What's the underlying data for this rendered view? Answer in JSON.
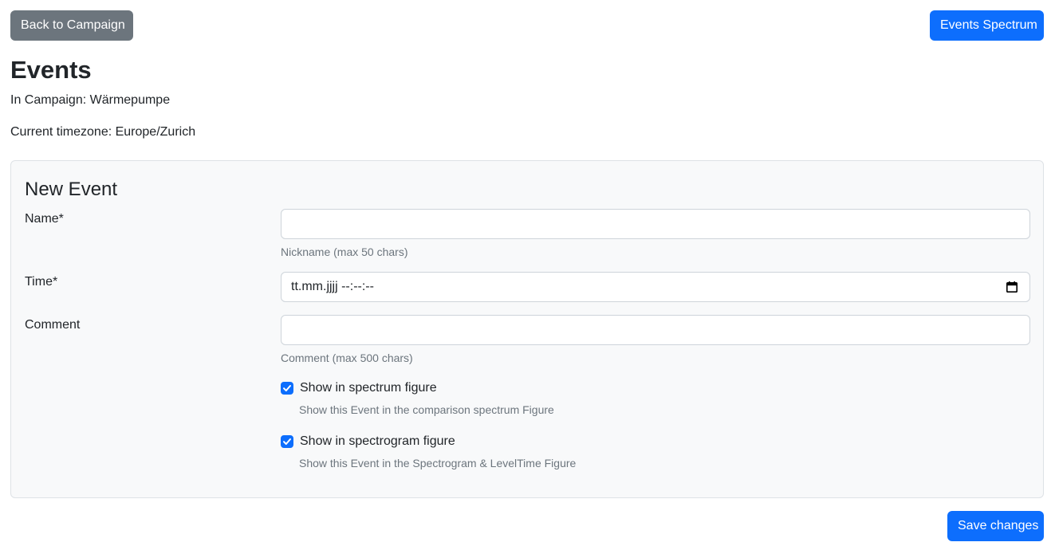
{
  "header": {
    "back_label": "Back to Campaign",
    "spectrum_label": "Events Spectrum"
  },
  "page": {
    "title": "Events",
    "campaign_line": "In Campaign: Wärmepumpe",
    "timezone_line": "Current timezone: Europe/Zurich"
  },
  "form": {
    "title": "New Event",
    "name": {
      "label": "Name*",
      "value": "",
      "help": "Nickname (max 50 chars)"
    },
    "time": {
      "label": "Time*",
      "placeholder": "tt.mm.jjjj --:--:--",
      "icon": "calendar-icon"
    },
    "comment": {
      "label": "Comment",
      "value": "",
      "help": "Comment (max 500 chars)"
    },
    "show_spectrum": {
      "label": "Show in spectrum figure",
      "checked": true,
      "help": "Show this Event in the comparison spectrum Figure"
    },
    "show_spectrogram": {
      "label": "Show in spectrogram figure",
      "checked": true,
      "help": "Show this Event in the Spectrogram & LevelTime Figure"
    },
    "save_label": "Save changes"
  },
  "colors": {
    "primary": "#0d6efd",
    "secondary": "#6c757d",
    "card_bg": "#f8f9fa",
    "muted": "#6c757d"
  }
}
